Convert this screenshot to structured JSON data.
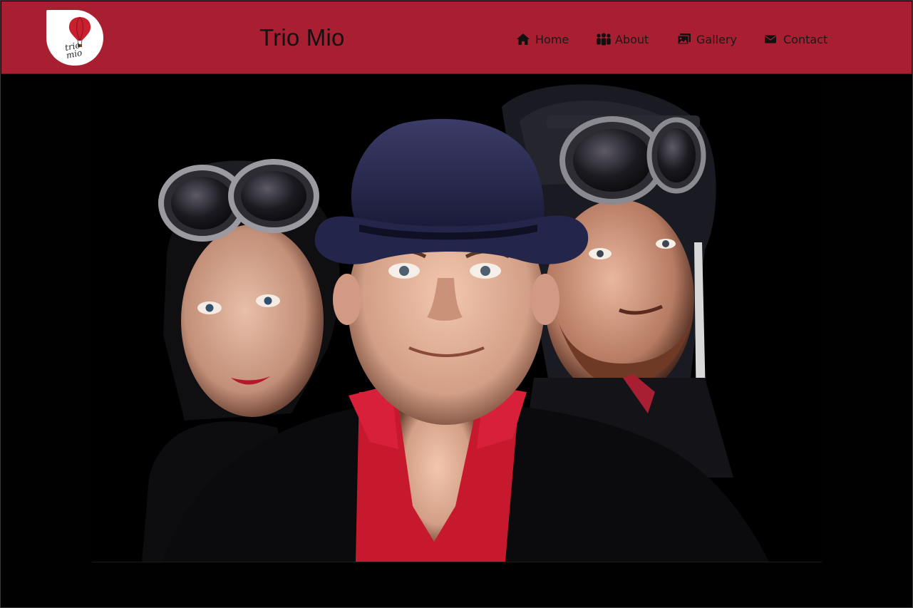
{
  "site": {
    "title": "Trio Mio",
    "logo": {
      "text": "trio mio",
      "icon": "hot-air-balloon-icon",
      "balloon_color": "#c9202f"
    }
  },
  "nav": {
    "items": [
      {
        "label": "Home",
        "icon": "home-icon"
      },
      {
        "label": "About",
        "icon": "people-icon"
      },
      {
        "label": "Gallery",
        "icon": "images-icon"
      },
      {
        "label": "Contact",
        "icon": "envelope-icon"
      }
    ]
  },
  "hero": {
    "image_subject": "three performers: woman with aviator goggles, man in bowler hat with red shirt, bearded man in aviator helmet"
  },
  "colors": {
    "header_bg": "#a81f31",
    "page_bg": "#000000",
    "text": "#111111"
  }
}
